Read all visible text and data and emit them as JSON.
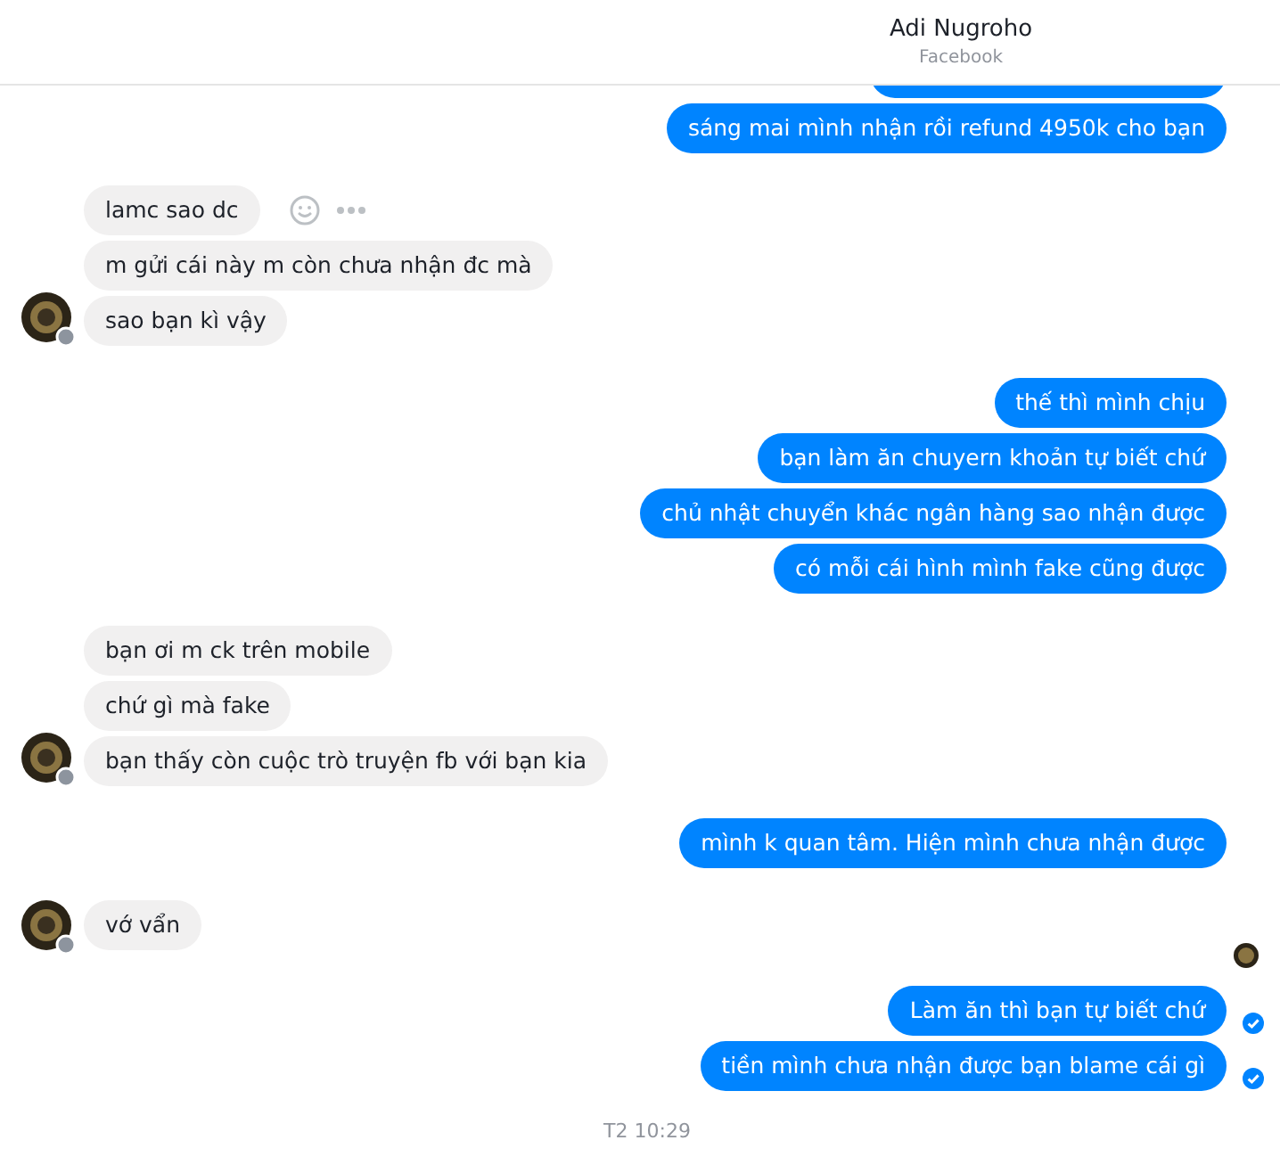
{
  "header": {
    "title": "Adi Nugroho",
    "subtitle": "Facebook"
  },
  "items": [
    {
      "kind": "group",
      "outgoing": true,
      "messages": [
        {
          "kind": "cut"
        },
        {
          "text": "sáng mai mình nhận rồi refund 4950k cho bạn"
        }
      ]
    },
    {
      "kind": "group",
      "outgoing": false,
      "messages": [
        {
          "text": "lamc sao dc",
          "actions": true
        },
        {
          "text": "m gửi cái này m còn chưa nhận đc mà"
        },
        {
          "text": "sao bạn kì vậy"
        }
      ]
    },
    {
      "kind": "group",
      "outgoing": true,
      "messages": [
        {
          "text": "thế thì mình chịu"
        },
        {
          "text": "bạn làm ăn chuyern khoản tự biết chứ"
        },
        {
          "text": "chủ nhật chuyển khác ngân hàng sao nhận được"
        },
        {
          "text": "có mỗi cái hình mình fake cũng được"
        }
      ]
    },
    {
      "kind": "group",
      "outgoing": false,
      "messages": [
        {
          "text": "bạn ơi m ck trên mobile"
        },
        {
          "text": "chứ gì mà fake"
        },
        {
          "text": "bạn thấy còn cuộc trò truyện fb với bạn kia"
        }
      ]
    },
    {
      "kind": "group",
      "outgoing": true,
      "messages": [
        {
          "text": "mình k quan tâm. Hiện mình chưa nhận được"
        }
      ]
    },
    {
      "kind": "group",
      "outgoing": false,
      "messages": [
        {
          "text": "vớ vẩn"
        }
      ]
    },
    {
      "kind": "seen"
    },
    {
      "kind": "group",
      "outgoing": true,
      "messages": [
        {
          "text": "Làm ăn thì bạn tự biết chứ",
          "delivered": true
        },
        {
          "text": "tiền mình chưa nhận được bạn blame cái gì",
          "delivered": true
        }
      ]
    },
    {
      "kind": "timestamp",
      "text": "T2 10:29"
    }
  ]
}
